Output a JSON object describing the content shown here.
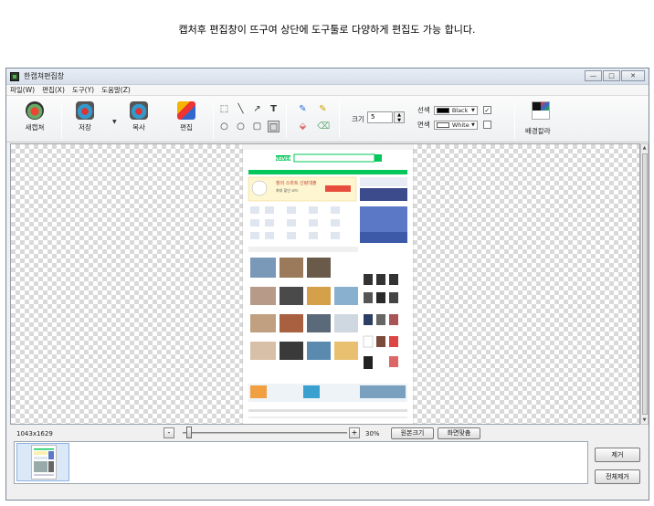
{
  "caption": "캡처후 편집창이 뜨구여 상단에 도구툴로 다양하게 편집도 가능 합니다.",
  "window": {
    "title": "한캡쳐편집창",
    "controls": [
      "—",
      "□",
      "✕"
    ]
  },
  "menu": [
    "파일(W)",
    "편집(X)",
    "도구(Y)",
    "도움말(Z)"
  ],
  "toolbar": {
    "new_label": "새캡쳐",
    "save_label": "저장",
    "copy_label": "복사",
    "edit_label": "편집",
    "size_label": "크기",
    "size_value": "5",
    "line_label": "선색",
    "line_color_name": "Black",
    "line_color": "#000000",
    "fill_label": "면색",
    "fill_color_name": "White",
    "fill_color": "#ffffff",
    "line_checked": "✓",
    "bg_color_label": "배경칼라"
  },
  "status": {
    "dimensions": "1043x1629",
    "zoom_percent": "30%",
    "minus": "-",
    "plus": "+",
    "original_size": "원본크기",
    "fit_screen": "화면맞춤"
  },
  "side_buttons": {
    "remove": "제거",
    "remove_all": "전체제거"
  },
  "preview": {
    "site_logo": "NAVER",
    "promo_text": "창의 스마트 신랑대출",
    "promo_sub": "최대 할인 코드"
  }
}
